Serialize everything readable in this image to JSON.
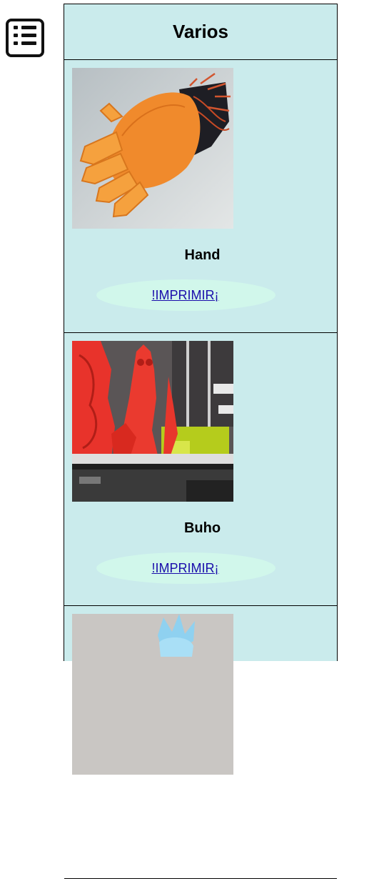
{
  "header": {
    "menu_icon": "list-menu-icon"
  },
  "page": {
    "title": "Varios"
  },
  "products": [
    {
      "name": "Hand",
      "button_label": "!IMPRIMIR¡",
      "image": "orange-3d-printed-robotic-hand"
    },
    {
      "name": "Buho",
      "button_label": "!IMPRIMIR¡",
      "image": "red-3d-printed-figures-on-printer-bed"
    },
    {
      "name": "",
      "button_label": "",
      "image": "3d-printed-figure-blue-hair"
    }
  ],
  "colors": {
    "panel_background": "#caebec",
    "button_background": "#d1f7eb",
    "link": "#1a0dab",
    "border": "#000000"
  }
}
